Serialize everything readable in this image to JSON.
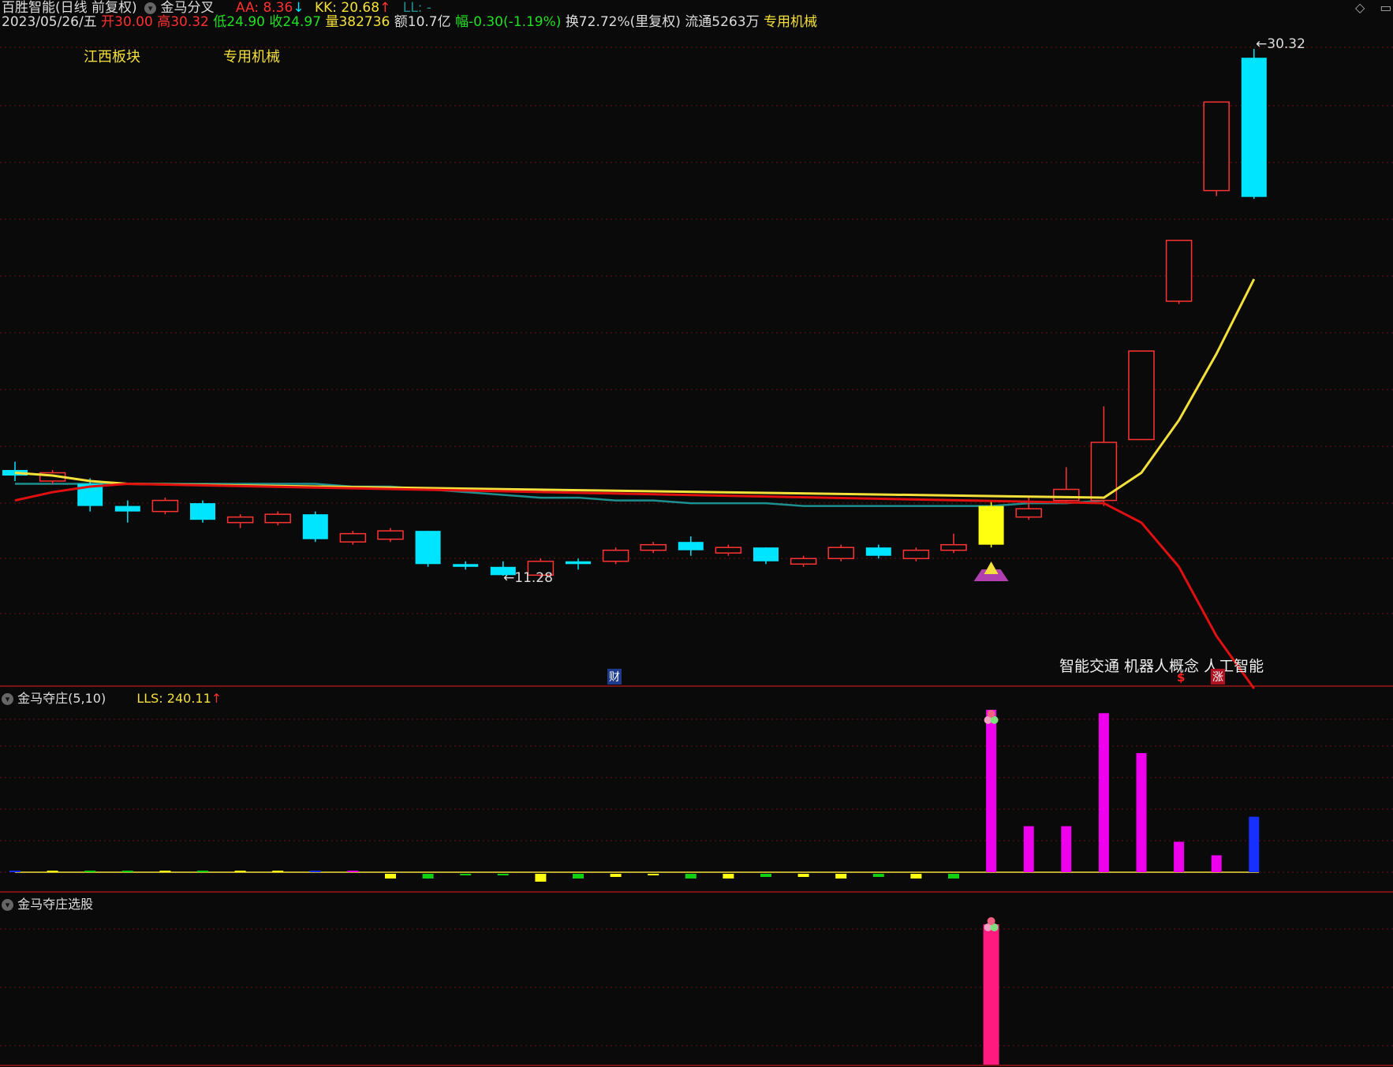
{
  "header": {
    "stock_name": "百胜智能(日线 前复权)",
    "indicator_name": "金马分叉",
    "aa": "AA: 8.36",
    "aa_arrow": "↓",
    "kk": "KK: 20.68",
    "kk_arrow": "↑",
    "ll": "LL: -",
    "date": "2023/05/26/五",
    "open_label": "开",
    "open": "30.00",
    "high_label": "高",
    "high": "30.32",
    "low_label": "低",
    "low": "24.90",
    "close_label": "收",
    "close": "24.97",
    "volume_label": "量",
    "volume": "382736",
    "amount": "额10.7亿",
    "change_label": "幅",
    "change": "-0.30(-1.19%)",
    "turnover": "换72.72%(里复权)",
    "float_shares": "流通5263万",
    "industry": "专用机械"
  },
  "main_panel": {
    "sector_tag_1": "江西板块",
    "sector_tag_2": "专用机械",
    "high_mark": "30.32",
    "low_mark": "11.28",
    "concepts": "智能交通 机器人概念 人工智能",
    "badge_cai": "财",
    "badge_dollar": "$",
    "badge_zhang": "涨"
  },
  "panel2": {
    "title": "金马夺庄(5,10)",
    "lls": "LLS: 240.11",
    "lls_arrow": "↑"
  },
  "panel3": {
    "title": "金马夺庄选股"
  },
  "colors": {
    "up": "#ff3333",
    "down": "#00e5ff",
    "yellow_line": "#f4e03a",
    "red_line": "#e01010",
    "teal_line": "#1e8e8e",
    "magenta": "#ee00ee",
    "pink": "#ff1a80"
  },
  "chart_data": {
    "type": "candlestick",
    "y_high": 30.32,
    "y_low": 11.28,
    "candles": [
      {
        "o": 15.1,
        "c": 14.9,
        "h": 15.4,
        "l": 14.7
      },
      {
        "o": 14.7,
        "c": 15.0,
        "h": 15.1,
        "l": 14.6
      },
      {
        "o": 14.6,
        "c": 13.8,
        "h": 14.8,
        "l": 13.6
      },
      {
        "o": 13.8,
        "c": 13.6,
        "h": 14.0,
        "l": 13.2
      },
      {
        "o": 13.6,
        "c": 14.0,
        "h": 14.1,
        "l": 13.5
      },
      {
        "o": 13.9,
        "c": 13.3,
        "h": 14.0,
        "l": 13.2
      },
      {
        "o": 13.2,
        "c": 13.4,
        "h": 13.5,
        "l": 13.0
      },
      {
        "o": 13.2,
        "c": 13.5,
        "h": 13.6,
        "l": 13.1
      },
      {
        "o": 13.5,
        "c": 12.6,
        "h": 13.6,
        "l": 12.5
      },
      {
        "o": 12.5,
        "c": 12.8,
        "h": 12.9,
        "l": 12.4
      },
      {
        "o": 12.6,
        "c": 12.9,
        "h": 13.0,
        "l": 12.5
      },
      {
        "o": 12.9,
        "c": 11.7,
        "h": 12.9,
        "l": 11.6
      },
      {
        "o": 11.7,
        "c": 11.6,
        "h": 11.8,
        "l": 11.5
      },
      {
        "o": 11.6,
        "c": 11.3,
        "h": 11.8,
        "l": 11.28
      },
      {
        "o": 11.3,
        "c": 11.8,
        "h": 11.9,
        "l": 11.2
      },
      {
        "o": 11.8,
        "c": 11.7,
        "h": 11.9,
        "l": 11.5
      },
      {
        "o": 11.8,
        "c": 12.2,
        "h": 12.3,
        "l": 11.7
      },
      {
        "o": 12.2,
        "c": 12.4,
        "h": 12.5,
        "l": 12.1
      },
      {
        "o": 12.5,
        "c": 12.2,
        "h": 12.7,
        "l": 12.0
      },
      {
        "o": 12.1,
        "c": 12.3,
        "h": 12.4,
        "l": 12.0
      },
      {
        "o": 12.3,
        "c": 11.8,
        "h": 12.3,
        "l": 11.7
      },
      {
        "o": 11.7,
        "c": 11.9,
        "h": 12.0,
        "l": 11.6
      },
      {
        "o": 11.9,
        "c": 12.3,
        "h": 12.4,
        "l": 11.8
      },
      {
        "o": 12.3,
        "c": 12.0,
        "h": 12.4,
        "l": 11.9
      },
      {
        "o": 11.9,
        "c": 12.2,
        "h": 12.3,
        "l": 11.8
      },
      {
        "o": 12.2,
        "c": 12.4,
        "h": 12.8,
        "l": 12.1
      },
      {
        "o": 12.4,
        "c": 13.8,
        "h": 14.0,
        "l": 12.3
      },
      {
        "o": 13.4,
        "c": 13.7,
        "h": 14.1,
        "l": 13.3
      },
      {
        "o": 14.0,
        "c": 14.4,
        "h": 15.2,
        "l": 13.9
      },
      {
        "o": 14.0,
        "c": 16.1,
        "h": 17.4,
        "l": 13.8
      },
      {
        "o": 16.2,
        "c": 19.4,
        "h": 19.4,
        "l": 16.2
      },
      {
        "o": 21.2,
        "c": 23.4,
        "h": 23.4,
        "l": 21.1
      },
      {
        "o": 25.2,
        "c": 28.4,
        "h": 28.4,
        "l": 25.0
      },
      {
        "o": 30.0,
        "c": 24.97,
        "h": 30.32,
        "l": 24.9
      }
    ],
    "lines": {
      "teal": [
        14.6,
        14.6,
        14.6,
        14.6,
        14.6,
        14.6,
        14.6,
        14.6,
        14.6,
        14.5,
        14.5,
        14.4,
        14.3,
        14.2,
        14.1,
        14.1,
        14.0,
        14.0,
        13.9,
        13.9,
        13.9,
        13.8,
        13.8,
        13.8,
        13.8,
        13.8,
        13.8,
        13.9,
        13.9,
        14.0
      ],
      "yellow": [
        [
          0,
          15.0
        ],
        [
          1,
          14.9
        ],
        [
          2,
          14.7
        ],
        [
          3,
          14.6
        ],
        [
          29,
          14.1
        ],
        [
          30,
          15.0
        ],
        [
          31,
          16.9
        ],
        [
          32,
          19.3
        ],
        [
          33,
          22.0
        ]
      ],
      "red": [
        [
          0,
          14.0
        ],
        [
          1,
          14.3
        ],
        [
          2,
          14.5
        ],
        [
          3,
          14.6
        ],
        [
          29,
          13.9
        ],
        [
          30,
          13.2
        ],
        [
          31,
          11.6
        ],
        [
          32,
          9.1
        ],
        [
          33,
          7.2
        ]
      ]
    },
    "panel2_bars": [
      {
        "v": 1,
        "c": "blue"
      },
      {
        "v": 1,
        "c": "yellow"
      },
      {
        "v": 1,
        "c": "green"
      },
      {
        "v": 1,
        "c": "green"
      },
      {
        "v": 1,
        "c": "yellow"
      },
      {
        "v": 1,
        "c": "green"
      },
      {
        "v": 1,
        "c": "yellow"
      },
      {
        "v": 1,
        "c": "yellow"
      },
      {
        "v": 1,
        "c": "blue"
      },
      {
        "v": 1.5,
        "c": "magenta"
      },
      {
        "v": -3,
        "c": "yellow"
      },
      {
        "v": -3,
        "c": "green"
      },
      {
        "v": -1,
        "c": "green"
      },
      {
        "v": -1,
        "c": "green"
      },
      {
        "v": -5,
        "c": "yellow"
      },
      {
        "v": -3,
        "c": "green"
      },
      {
        "v": -2,
        "c": "yellow"
      },
      {
        "v": -1,
        "c": "yellow"
      },
      {
        "v": -3,
        "c": "green"
      },
      {
        "v": -3,
        "c": "yellow"
      },
      {
        "v": -2,
        "c": "green"
      },
      {
        "v": -2,
        "c": "yellow"
      },
      {
        "v": -3,
        "c": "yellow"
      },
      {
        "v": -2,
        "c": "green"
      },
      {
        "v": -3,
        "c": "yellow"
      },
      {
        "v": -3,
        "c": "green"
      },
      {
        "v": 240,
        "c": "magenta"
      },
      {
        "v": 68,
        "c": "magenta"
      },
      {
        "v": 68,
        "c": "magenta"
      },
      {
        "v": 235,
        "c": "magenta"
      },
      {
        "v": 176,
        "c": "magenta"
      },
      {
        "v": 45,
        "c": "magenta"
      },
      {
        "v": 25,
        "c": "magenta"
      },
      {
        "v": 82,
        "c": "blue"
      }
    ],
    "panel3_signal_index": 26
  }
}
